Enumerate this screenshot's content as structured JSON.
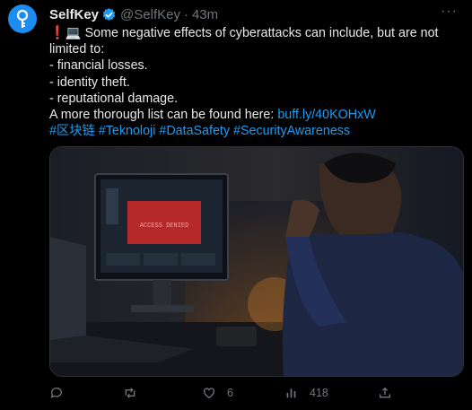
{
  "tweet": {
    "author_name": "SelfKey",
    "handle": "@SelfKey",
    "separator": "·",
    "time": "43m",
    "more_label": "···",
    "body_emojis": "❗💻",
    "body_line1": " Some negative effects of cyberattacks can include, but are not limited to:",
    "bullet1": "- financial losses.",
    "bullet2": "- identity theft.",
    "bullet3": "- reputational damage.",
    "more_list_prefix": "A more thorough list can be found here: ",
    "link": "buff.ly/40KOHxW",
    "hashtags": "#区块链 #Teknoloji #DataSafety #SecurityAwareness"
  },
  "media": {
    "screen_text": "ACCESS DENIED"
  },
  "actions": {
    "reply_count": "",
    "retweet_count": "",
    "like_count": "6",
    "views_count": "418"
  },
  "colors": {
    "background": "#000000",
    "text": "#e7e9ea",
    "secondary": "#71767b",
    "link": "#1d9bf0",
    "avatar": "#1d8cf0"
  }
}
